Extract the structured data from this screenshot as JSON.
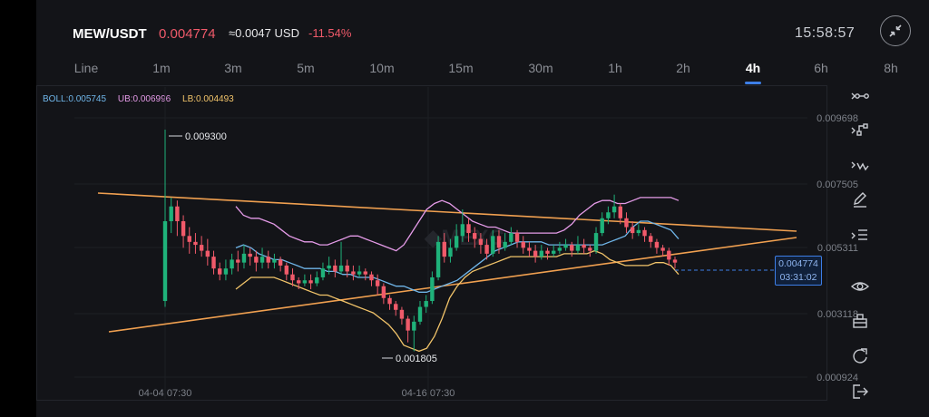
{
  "header": {
    "pair": "MEW/USDT",
    "price": "0.004774",
    "approx": "≈0.0047 USD",
    "change": "-11.54%",
    "clock": "15:58:57"
  },
  "tabs": [
    "Line",
    "1m",
    "3m",
    "5m",
    "10m",
    "15m",
    "30m",
    "1h",
    "2h",
    "4h",
    "6h",
    "8h"
  ],
  "active_tab": "4h",
  "legend": {
    "boll": "BOLL:0.005745",
    "ub": "UB:0.006996",
    "lb": "LB:0.004493"
  },
  "colors": {
    "up": "#1fb27a",
    "down": "#f05a6a",
    "mid": "#6fb5e8",
    "upper": "#e59be8",
    "lower": "#f2c46a",
    "trend": "#f0a050",
    "accent": "#3d7ee6"
  },
  "chart_data": {
    "type": "candlestick",
    "y_ticks": [
      "0.009698",
      "0.007505",
      "0.005311",
      "0.003118",
      "0.000924"
    ],
    "x_ticks": [
      "04-04 07:30",
      "04-16 07:30"
    ],
    "high_label": "0.009300",
    "low_label": "0.001805",
    "last_price": "0.004774",
    "countdown": "03:31:02",
    "candles": [
      [
        0.0035,
        0.0062,
        0.0093,
        0.0033
      ],
      [
        0.0062,
        0.0067,
        0.007,
        0.0058
      ],
      [
        0.0067,
        0.0062,
        0.0069,
        0.0057
      ],
      [
        0.0062,
        0.0057,
        0.0064,
        0.0053
      ],
      [
        0.0057,
        0.0055,
        0.006,
        0.0051
      ],
      [
        0.0055,
        0.0054,
        0.0058,
        0.0051
      ],
      [
        0.0054,
        0.0052,
        0.0057,
        0.005
      ],
      [
        0.0052,
        0.005,
        0.0056,
        0.0047
      ],
      [
        0.005,
        0.0046,
        0.0052,
        0.0044
      ],
      [
        0.0046,
        0.0044,
        0.0048,
        0.0042
      ],
      [
        0.0044,
        0.0046,
        0.0049,
        0.0042
      ],
      [
        0.0046,
        0.0049,
        0.0051,
        0.0044
      ],
      [
        0.0049,
        0.0048,
        0.0052,
        0.0045
      ],
      [
        0.0048,
        0.0051,
        0.0054,
        0.0046
      ],
      [
        0.0051,
        0.005,
        0.0053,
        0.0047
      ],
      [
        0.005,
        0.0048,
        0.0052,
        0.0045
      ],
      [
        0.0048,
        0.005,
        0.0053,
        0.0046
      ],
      [
        0.005,
        0.0048,
        0.0052,
        0.0046
      ],
      [
        0.0048,
        0.0049,
        0.0051,
        0.0046
      ],
      [
        0.0049,
        0.0047,
        0.005,
        0.0045
      ],
      [
        0.0047,
        0.0044,
        0.0048,
        0.0042
      ],
      [
        0.0044,
        0.0042,
        0.0046,
        0.004
      ],
      [
        0.0042,
        0.0041,
        0.0043,
        0.0039
      ],
      [
        0.0041,
        0.0042,
        0.0044,
        0.004
      ],
      [
        0.0042,
        0.0041,
        0.0044,
        0.0039
      ],
      [
        0.0041,
        0.0043,
        0.0045,
        0.004
      ],
      [
        0.0043,
        0.0046,
        0.0048,
        0.0042
      ],
      [
        0.0046,
        0.0047,
        0.005,
        0.0044
      ],
      [
        0.0047,
        0.0045,
        0.0049,
        0.0043
      ],
      [
        0.0045,
        0.0047,
        0.0055,
        0.0044
      ],
      [
        0.0047,
        0.0045,
        0.0049,
        0.0043
      ],
      [
        0.0045,
        0.0044,
        0.0047,
        0.0042
      ],
      [
        0.0044,
        0.0045,
        0.0047,
        0.0043
      ],
      [
        0.0045,
        0.0044,
        0.0046,
        0.0042
      ],
      [
        0.0044,
        0.0042,
        0.0045,
        0.004
      ],
      [
        0.0042,
        0.004,
        0.0044,
        0.0037
      ],
      [
        0.004,
        0.0036,
        0.0041,
        0.0034
      ],
      [
        0.0036,
        0.0034,
        0.0037,
        0.0032
      ],
      [
        0.0034,
        0.0032,
        0.0035,
        0.003
      ],
      [
        0.0032,
        0.0029,
        0.0033,
        0.0027
      ],
      [
        0.0029,
        0.0025,
        0.003,
        0.0021
      ],
      [
        0.0025,
        0.0028,
        0.003,
        0.0018
      ],
      [
        0.0028,
        0.0033,
        0.0035,
        0.0027
      ],
      [
        0.0033,
        0.0035,
        0.0037,
        0.0031
      ],
      [
        0.0035,
        0.0043,
        0.0045,
        0.0034
      ],
      [
        0.0043,
        0.0055,
        0.0057,
        0.0042
      ],
      [
        0.0055,
        0.005,
        0.0058,
        0.0048
      ],
      [
        0.005,
        0.0053,
        0.0056,
        0.0048
      ],
      [
        0.0053,
        0.0057,
        0.0061,
        0.0052
      ],
      [
        0.0057,
        0.0061,
        0.0066,
        0.0055
      ],
      [
        0.0061,
        0.0058,
        0.0063,
        0.0055
      ],
      [
        0.0058,
        0.0056,
        0.006,
        0.0053
      ],
      [
        0.0056,
        0.0054,
        0.0058,
        0.0051
      ],
      [
        0.0054,
        0.0051,
        0.0056,
        0.0049
      ],
      [
        0.0051,
        0.0057,
        0.0059,
        0.005
      ],
      [
        0.0057,
        0.0053,
        0.0059,
        0.0051
      ],
      [
        0.0053,
        0.0055,
        0.0058,
        0.0052
      ],
      [
        0.0055,
        0.0058,
        0.006,
        0.0054
      ],
      [
        0.0058,
        0.0055,
        0.0059,
        0.0053
      ],
      [
        0.0055,
        0.0053,
        0.0057,
        0.0051
      ],
      [
        0.0053,
        0.0052,
        0.0055,
        0.005
      ],
      [
        0.0052,
        0.005,
        0.0054,
        0.0048
      ],
      [
        0.005,
        0.0052,
        0.0054,
        0.0049
      ],
      [
        0.0052,
        0.0051,
        0.0053,
        0.0049
      ],
      [
        0.0051,
        0.0052,
        0.0054,
        0.005
      ],
      [
        0.0052,
        0.0053,
        0.0055,
        0.0051
      ],
      [
        0.0053,
        0.0054,
        0.0056,
        0.0052
      ],
      [
        0.0054,
        0.0052,
        0.0055,
        0.005
      ],
      [
        0.0052,
        0.0054,
        0.0057,
        0.0051
      ],
      [
        0.0054,
        0.0053,
        0.0056,
        0.0051
      ],
      [
        0.0053,
        0.0052,
        0.0054,
        0.005
      ],
      [
        0.0052,
        0.0058,
        0.006,
        0.0051
      ],
      [
        0.0058,
        0.0063,
        0.0065,
        0.0057
      ],
      [
        0.0063,
        0.0065,
        0.0067,
        0.0061
      ],
      [
        0.0065,
        0.0067,
        0.0071,
        0.0063
      ],
      [
        0.0067,
        0.0063,
        0.0068,
        0.0061
      ],
      [
        0.0063,
        0.006,
        0.0065,
        0.0058
      ],
      [
        0.006,
        0.0058,
        0.0062,
        0.0056
      ],
      [
        0.0058,
        0.0059,
        0.0061,
        0.0057
      ],
      [
        0.0059,
        0.0057,
        0.006,
        0.0055
      ],
      [
        0.0057,
        0.0055,
        0.0058,
        0.0053
      ],
      [
        0.0055,
        0.0053,
        0.0056,
        0.0051
      ],
      [
        0.0053,
        0.0052,
        0.0054,
        0.005
      ],
      [
        0.0052,
        0.0049,
        0.0053,
        0.0047
      ],
      [
        0.0049,
        0.0048,
        0.005,
        0.0046
      ]
    ],
    "mid": [
      0.0053,
      0.0054,
      0.0053,
      0.0051,
      0.005,
      0.0049,
      0.0049,
      0.0048,
      0.0047,
      0.0046,
      0.0046,
      0.0046,
      0.0045,
      0.0045,
      0.0044,
      0.0044,
      0.0043,
      0.0043,
      0.0043,
      0.0042,
      0.0041,
      0.004,
      0.004,
      0.0039,
      0.0038,
      0.0038,
      0.0039,
      0.004,
      0.0041,
      0.0042,
      0.0044,
      0.0046,
      0.0048,
      0.005,
      0.0052,
      0.0053,
      0.0054,
      0.0055,
      0.0055,
      0.0055,
      0.0055,
      0.0054,
      0.0054,
      0.0054,
      0.0054,
      0.0054,
      0.0054,
      0.0054,
      0.0054,
      0.0055,
      0.0056,
      0.0057,
      0.006,
      0.0062,
      0.0062,
      0.0061,
      0.006,
      0.0059,
      0.0056
    ],
    "upper": [
      0.0067,
      0.0064,
      0.0063,
      0.0063,
      0.0062,
      0.0061,
      0.0059,
      0.0057,
      0.0056,
      0.0055,
      0.0055,
      0.0054,
      0.0054,
      0.0055,
      0.0056,
      0.0057,
      0.0057,
      0.0056,
      0.0055,
      0.0054,
      0.0053,
      0.0052,
      0.0054,
      0.0058,
      0.0062,
      0.0066,
      0.0068,
      0.0069,
      0.0068,
      0.0066,
      0.0064,
      0.0062,
      0.0061,
      0.006,
      0.006,
      0.0059,
      0.0058,
      0.0058,
      0.0058,
      0.0058,
      0.0058,
      0.0058,
      0.0058,
      0.0059,
      0.0061,
      0.0064,
      0.0066,
      0.0068,
      0.0069,
      0.0069,
      0.0068,
      0.0068,
      0.0069,
      0.007,
      0.007,
      0.007,
      0.007,
      0.007,
      0.0069
    ],
    "lower": [
      0.0039,
      0.0041,
      0.0043,
      0.0043,
      0.0043,
      0.0043,
      0.0042,
      0.0041,
      0.004,
      0.0039,
      0.0038,
      0.0037,
      0.0037,
      0.0036,
      0.0035,
      0.0034,
      0.0033,
      0.0032,
      0.0031,
      0.0029,
      0.0027,
      0.0024,
      0.002,
      0.0019,
      0.0018,
      0.0019,
      0.0023,
      0.0029,
      0.0036,
      0.004,
      0.0043,
      0.0045,
      0.0046,
      0.0047,
      0.0048,
      0.0049,
      0.005,
      0.005,
      0.005,
      0.005,
      0.005,
      0.005,
      0.005,
      0.0051,
      0.0051,
      0.0051,
      0.0051,
      0.0052,
      0.0051,
      0.0049,
      0.0048,
      0.0047,
      0.0047,
      0.0047,
      0.0047,
      0.0048,
      0.0048,
      0.0047,
      0.0044
    ]
  },
  "toolbar": [
    "ray-tool-icon",
    "path-tool-icon",
    "wave-tool-icon",
    "pencil-icon",
    "fib-lines-icon",
    "eye-icon",
    "layers-icon",
    "refresh-icon",
    "exit-icon"
  ]
}
